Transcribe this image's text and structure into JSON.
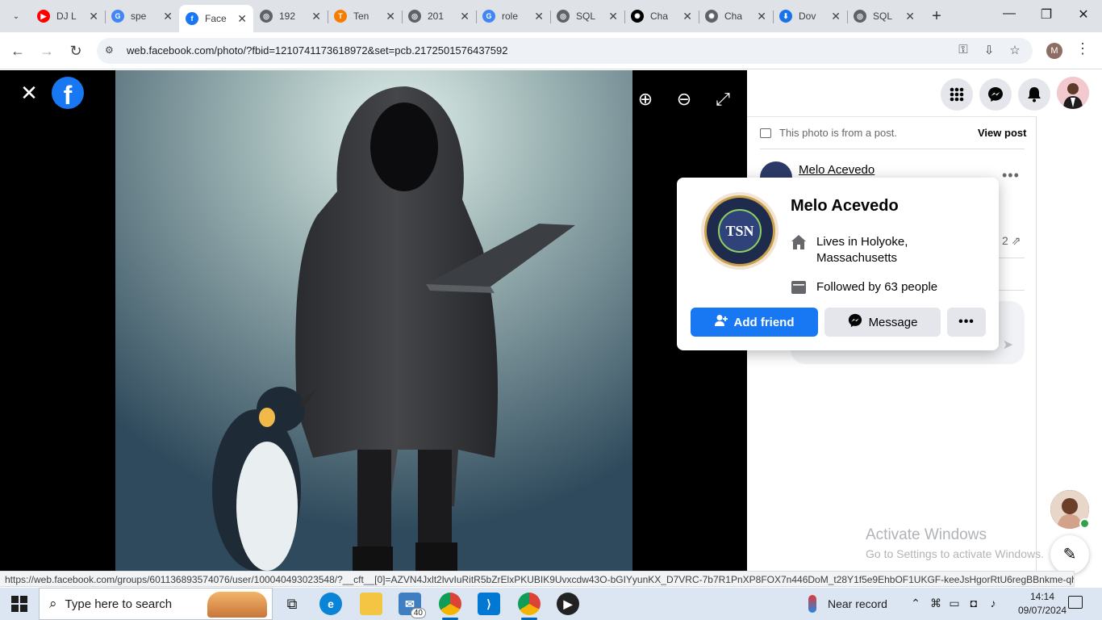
{
  "browser": {
    "tabs": [
      {
        "title": "DJ L",
        "fav_color": "#ff0000",
        "fav_glyph": "▶"
      },
      {
        "title": "spe",
        "fav_color": "#4285f4",
        "fav_glyph": "G"
      },
      {
        "title": "Face",
        "fav_color": "#1877f2",
        "fav_glyph": "f",
        "active": true
      },
      {
        "title": "192",
        "fav_color": "#5f6368",
        "fav_glyph": "◎"
      },
      {
        "title": "Ten",
        "fav_color": "#f57c00",
        "fav_glyph": "T"
      },
      {
        "title": "201",
        "fav_color": "#5f6368",
        "fav_glyph": "◎"
      },
      {
        "title": "role",
        "fav_color": "#4285f4",
        "fav_glyph": "G"
      },
      {
        "title": "SQL",
        "fav_color": "#5f6368",
        "fav_glyph": "◎"
      },
      {
        "title": "Cha",
        "fav_color": "#000000",
        "fav_glyph": "✺"
      },
      {
        "title": "Cha",
        "fav_color": "#5f6368",
        "fav_glyph": "✺"
      },
      {
        "title": "Dov",
        "fav_color": "#1a73e8",
        "fav_glyph": "⬇"
      },
      {
        "title": "SQL",
        "fav_color": "#5f6368",
        "fav_glyph": "◎"
      }
    ],
    "url": "web.facebook.com/photo/?fbid=1210741173618972&set=pcb.2172501576437592",
    "profile_initial": "M",
    "status_url": "https://web.facebook.com/groups/601136893574076/user/100040493023548/?__cft__[0]=AZVN4Jxlt2lvvIuRitR5bZrElxPKUBIK9Uvxcdw43O-bGIYyunKX_D7VRC-7b7R1PnXP8FOX7n446DoM_t28Y1f5e9EhbOF1UKGF-keeJsHgorRtU6regBBnkme-qhtiURg..."
  },
  "post_panel": {
    "note": "This photo is from a post.",
    "view_post": "View post",
    "author": "Melo Acevedo",
    "share_count": "2"
  },
  "hover_card": {
    "name": "Melo Acevedo",
    "avatar_text": "TSN",
    "lives_prefix": "Lives in ",
    "lives_place": "Holyoke, Massachusetts",
    "followed_prefix": "Followed by ",
    "followed_count": "63 people",
    "add_friend": "Add friend",
    "message": "Message"
  },
  "watermark": {
    "line1": "Activate Windows",
    "line2": "Go to Settings to activate Windows."
  },
  "taskbar": {
    "search_placeholder": "Type here to search",
    "mail_badge": "40",
    "weather": "Near record",
    "time": "14:14",
    "date": "09/07/2024"
  },
  "colors": {
    "facebook_blue": "#1877f2",
    "panel_gray": "#e4e6eb"
  }
}
